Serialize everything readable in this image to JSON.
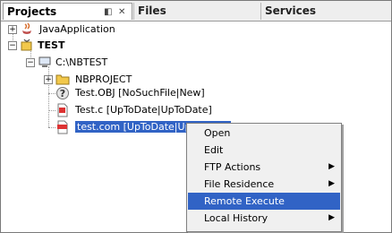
{
  "tabs": {
    "projects": "Projects",
    "files": "Files",
    "services": "Services",
    "minimize_glyph": "◧",
    "close_glyph": "✕"
  },
  "tree": {
    "java_app": "JavaApplication",
    "test": "TEST",
    "folder_root": "C:\\NBTEST",
    "nbproject": "NBPROJECT",
    "file_obj": "Test.OBJ [NoSuchFile|New]",
    "file_c": "Test.c [UpToDate|UpToDate]",
    "file_com": "test.com [UpToDate|UpToDate]"
  },
  "context_menu": {
    "items": [
      {
        "label": "Open",
        "submenu": false
      },
      {
        "label": "Edit",
        "submenu": false
      },
      {
        "label": "FTP Actions",
        "submenu": true
      },
      {
        "label": "File Residence",
        "submenu": true
      },
      {
        "label": "Remote Execute",
        "submenu": false,
        "highlighted": true
      },
      {
        "label": "Local History",
        "submenu": true
      }
    ]
  },
  "icons": {
    "expand_collapsed": "+",
    "expand_open": "−",
    "submenu_arrow": "▶",
    "unknown_file_glyph": "?"
  },
  "colors": {
    "selection": "#3163c5",
    "menu_bg": "#f0f0f0",
    "folder": "#f2c84b"
  }
}
